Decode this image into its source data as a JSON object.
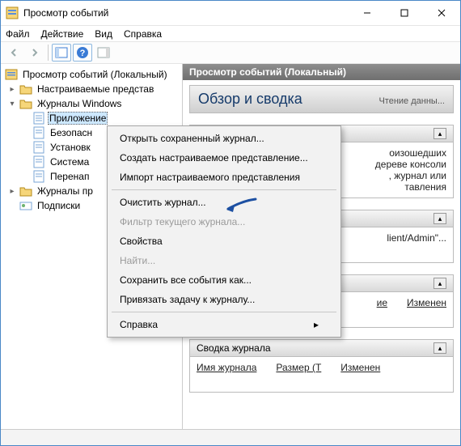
{
  "window": {
    "title": "Просмотр событий"
  },
  "menu": {
    "file": "Файл",
    "action": "Действие",
    "view": "Вид",
    "help": "Справка"
  },
  "tree": {
    "root": "Просмотр событий (Локальный)",
    "custom_views": "Настраиваемые представ",
    "win_logs": "Журналы Windows",
    "app": "Приложение",
    "security": "Безопасн",
    "setup": "Установк",
    "system": "Система",
    "forwarded": "Перенап",
    "app_services": "Журналы пр",
    "subscriptions": "Подписки"
  },
  "right": {
    "header": "Просмотр событий (Локальный)",
    "panel_title": "Обзор и сводка",
    "panel_sub": "Чтение данны...",
    "overview_text1": "оизошедших",
    "overview_text2": "дереве консоли",
    "overview_text3": ", журнал или",
    "overview_text4": "тавления",
    "section2_head": "",
    "section2_text": "lient/Admin\"...",
    "section3_head": "",
    "col_name": "ие",
    "col_changed": "Изменен",
    "section4_head": "Сводка журнала",
    "log_name": "Имя журнала",
    "log_size": "Размер (Т",
    "log_changed": "Изменен"
  },
  "ctx": {
    "open_saved": "Открыть сохраненный журнал...",
    "create_custom": "Создать настраиваемое представление...",
    "import_custom": "Импорт настраиваемого представления",
    "clear_log": "Очистить журнал...",
    "filter_current": "Фильтр текущего журнала...",
    "properties": "Свойства",
    "find": "Найти...",
    "save_all": "Сохранить все события как...",
    "attach_task": "Привязать задачу к журналу...",
    "help": "Справка"
  }
}
